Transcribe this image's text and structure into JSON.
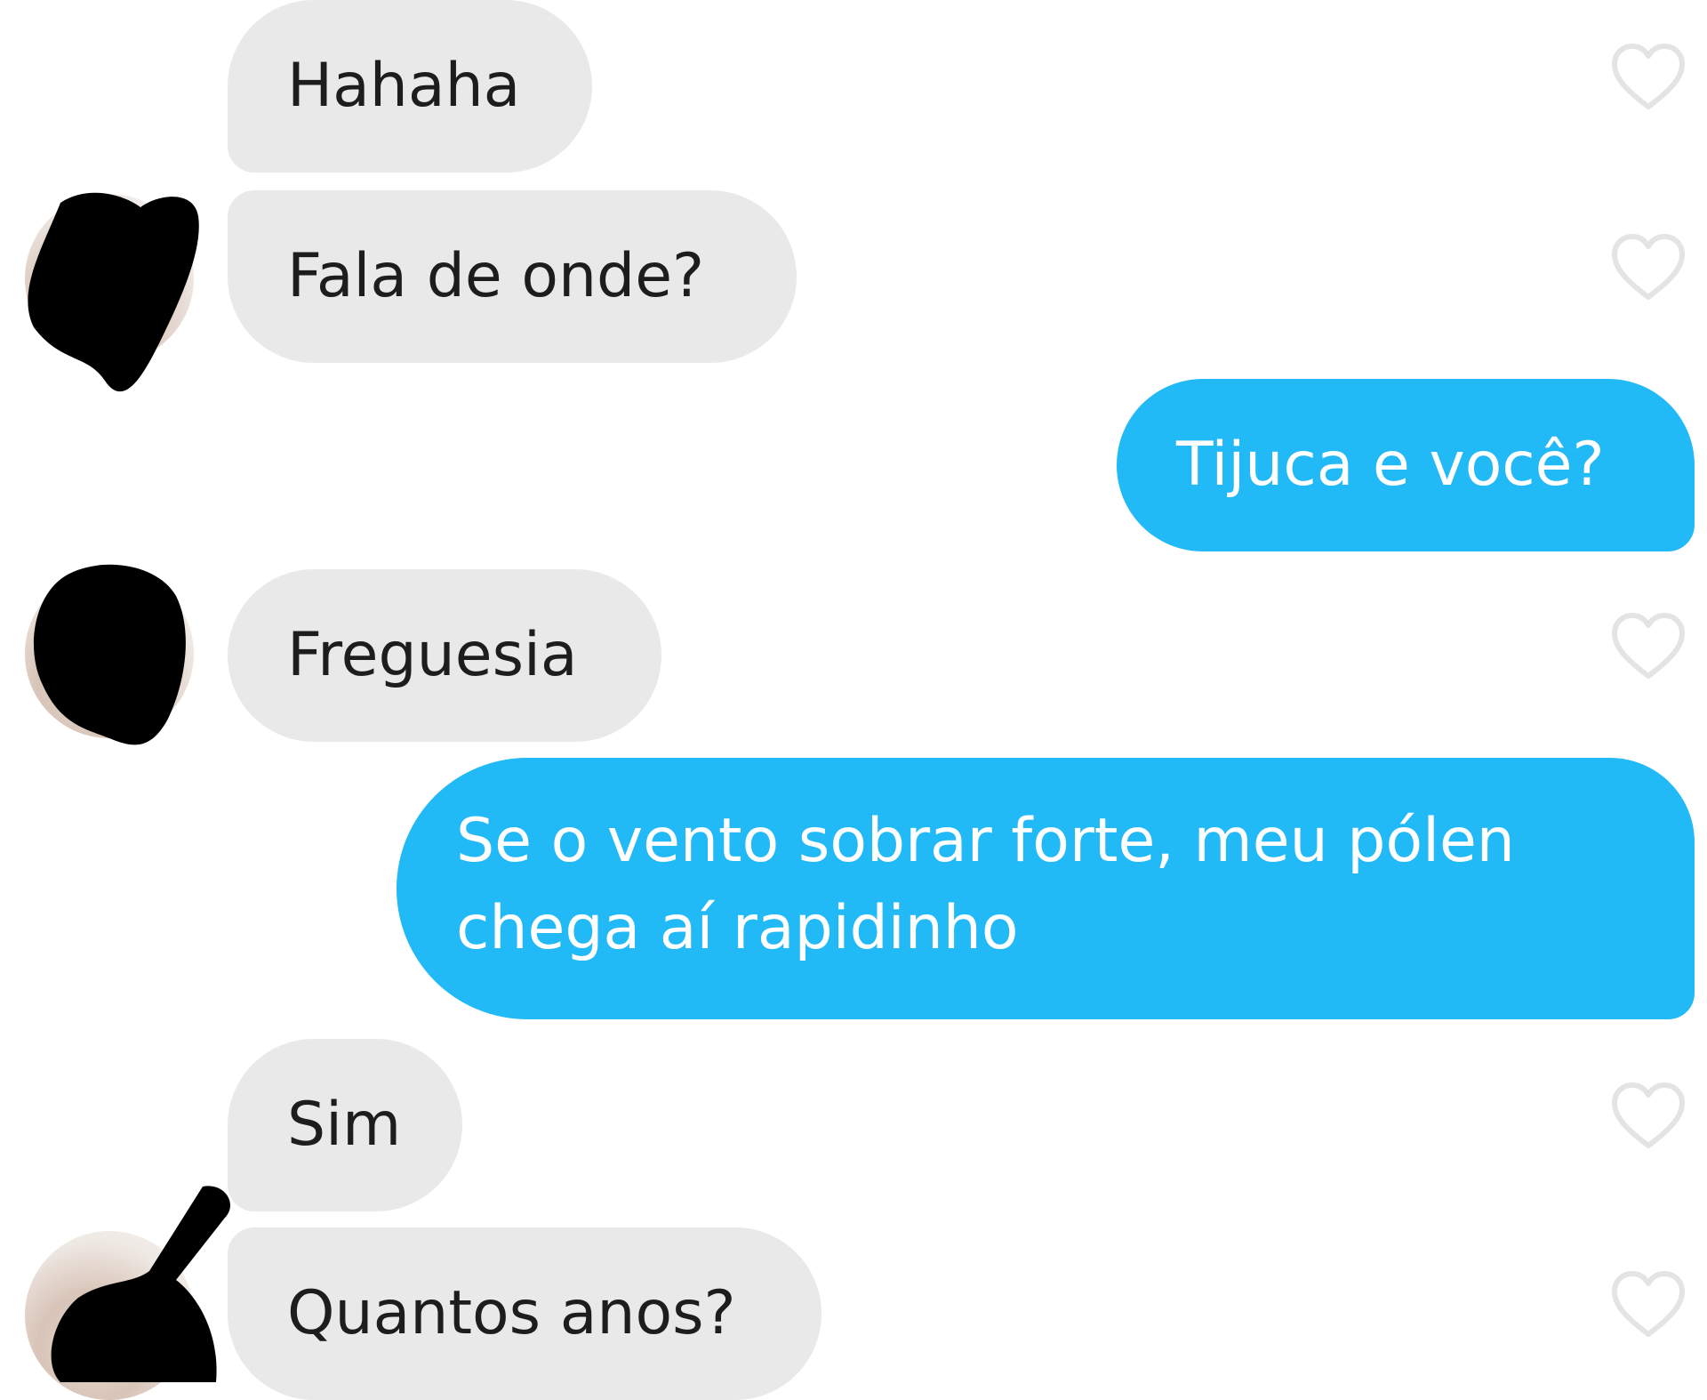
{
  "messages": [
    {
      "direction": "incoming",
      "text": "Hahaha",
      "liked": false
    },
    {
      "direction": "incoming",
      "text": "Fala de onde?",
      "liked": false,
      "avatar": true
    },
    {
      "direction": "outgoing",
      "text": "Tijuca e você?"
    },
    {
      "direction": "incoming",
      "text": "Freguesia",
      "liked": false,
      "avatar": true
    },
    {
      "direction": "outgoing",
      "lines": [
        "Se o vento sobrar forte, meu pólen",
        "chega aí rapidinho"
      ]
    },
    {
      "direction": "incoming",
      "text": "Sim",
      "liked": false
    },
    {
      "direction": "incoming",
      "text": "Quantos anos?",
      "liked": false,
      "avatar": true
    }
  ],
  "colors": {
    "incoming_bubble": "#e9e9e9",
    "outgoing_bubble": "#22b9f7",
    "incoming_text": "#1d1d1d",
    "outgoing_text": "#ffffff",
    "heart_outline": "#e4e4e4",
    "redaction": "#000000"
  },
  "icons": {
    "like": "heart-outline-icon",
    "avatar": "contact-avatar"
  }
}
